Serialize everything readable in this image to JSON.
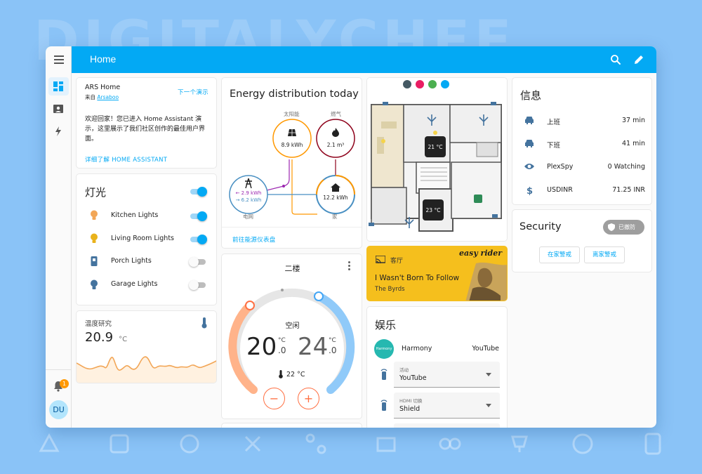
{
  "background": {
    "watermark": "DIGITALYCHEF"
  },
  "header": {
    "title": "Home"
  },
  "sidebar": {
    "items": [
      {
        "icon": "dashboard-icon",
        "active": true
      },
      {
        "icon": "energy-map-icon",
        "active": false
      },
      {
        "icon": "lightning-icon",
        "active": false
      }
    ],
    "notification_count": "1",
    "user_initials": "DU"
  },
  "welcome": {
    "title": "ARS Home",
    "from_prefix": "来自",
    "from_link": "Arsaboo",
    "next_demo": "下一个演示",
    "body": "欢迎回家！您已进入 Home Assistant 演示，这里展示了我们社区创作的最佳用户界面。",
    "learn_more": "详细了解 HOME ASSISTANT"
  },
  "lights": {
    "title": "灯光",
    "master_on": true,
    "items": [
      {
        "label": "Kitchen Lights",
        "on": true,
        "icon_color": "#f2a657"
      },
      {
        "label": "Living Room Lights",
        "on": true,
        "icon_color": "#e9b21b"
      },
      {
        "label": "Porch Lights",
        "on": false,
        "icon_color": "#44739e"
      },
      {
        "label": "Garage Lights",
        "on": false,
        "icon_color": "#44739e"
      }
    ]
  },
  "temperature_study": {
    "title": "温度研究",
    "value": "20.9",
    "unit": "°C"
  },
  "energy": {
    "title": "Energy distribution today",
    "solar": {
      "label": "太阳能",
      "value": "8.9 kWh",
      "color": "#ff9800"
    },
    "gas": {
      "label": "燃气",
      "value": "2.1 m³",
      "color": "#8e021b"
    },
    "grid": {
      "label": "电网",
      "import": "← 2.9 kWh",
      "export": "→ 6.2 kWh",
      "color": "#488fc2"
    },
    "home": {
      "label": "家",
      "value": "12.2 kWh"
    },
    "link": "前往能源仪表盘"
  },
  "thermostat": {
    "title": "二楼",
    "mode": "空闲",
    "low": "20",
    "low_decimal": ".0",
    "high": "24",
    "high_decimal": ".0",
    "unit": "°C",
    "current": "22 °C",
    "minus": "−",
    "plus": "+"
  },
  "floorplan": {
    "temp_1": "21 °C",
    "temp_2": "23 °C"
  },
  "media": {
    "room": "客厅",
    "track": "I Wasn't Born To Follow",
    "artist": "The Byrds",
    "art_text": "easy rider",
    "bg_color": "#f5bf1d"
  },
  "entertainment": {
    "title": "娱乐",
    "harmony_label": "Harmony",
    "harmony_value": "YouTube",
    "harmony_logo": "Harmony",
    "activity_label": "活动",
    "activity_value": "YouTube",
    "hdmi_label": "HDMI 切换",
    "hdmi_value": "Shield"
  },
  "info": {
    "title": "信息",
    "rows": [
      {
        "icon": "car-icon",
        "label": "上班",
        "value": "37 min"
      },
      {
        "icon": "car-icon",
        "label": "下班",
        "value": "41 min"
      },
      {
        "icon": "eye-icon",
        "label": "PlexSpy",
        "value": "0 Watching"
      },
      {
        "icon": "dollar-icon",
        "label": "USDINR",
        "value": "71.25 INR"
      }
    ]
  },
  "security": {
    "title": "Security",
    "status": "已撤防",
    "arm_home": "在家警戒",
    "arm_away": "离家警戒"
  }
}
